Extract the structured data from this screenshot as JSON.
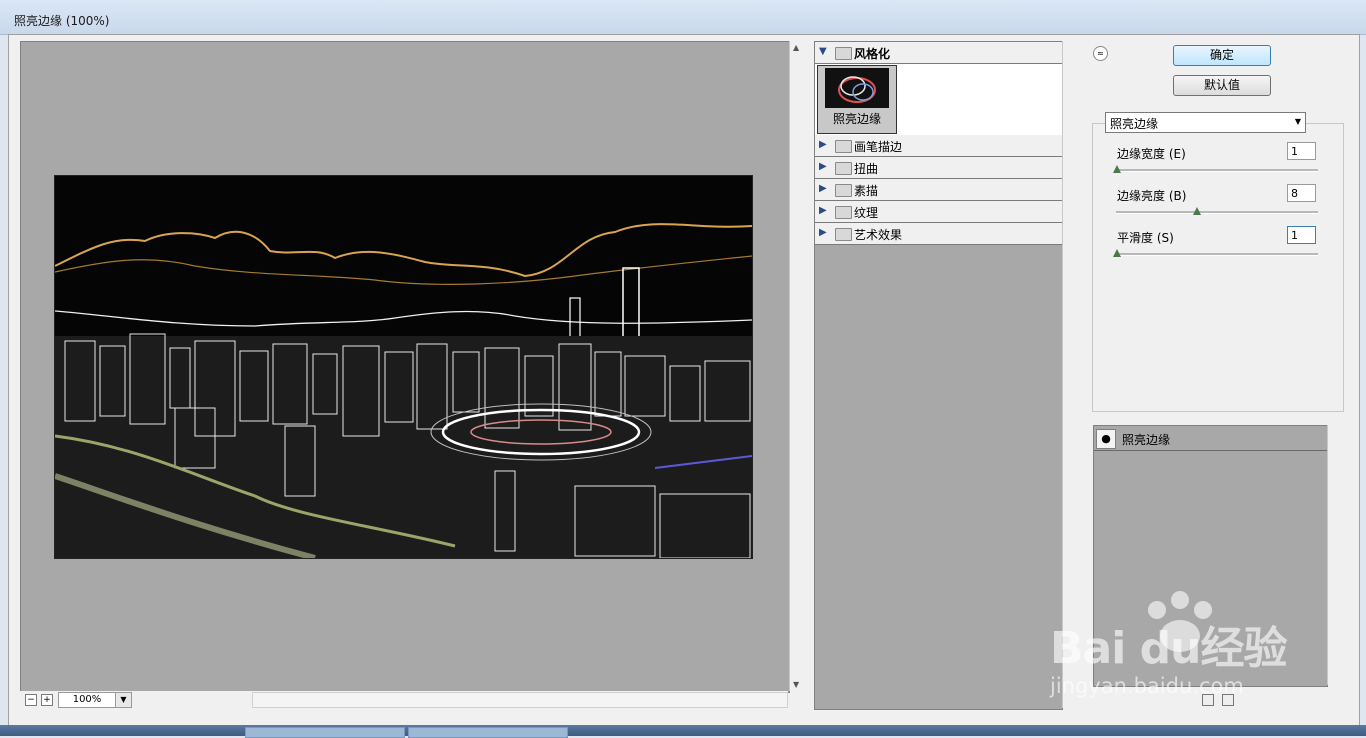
{
  "window": {
    "title": "照亮边缘 (100%)"
  },
  "preview": {
    "zoom": "100%",
    "zoom_out": "−",
    "zoom_in": "+"
  },
  "gallery": {
    "open_category": "风格化",
    "selected_filter": "照亮边缘",
    "categories": [
      "画笔描边",
      "扭曲",
      "素描",
      "纹理",
      "艺术效果"
    ]
  },
  "buttons": {
    "ok": "确定",
    "default": "默认值",
    "collapse": "≈"
  },
  "filter_select": {
    "value": "照亮边缘"
  },
  "params": [
    {
      "label": "边缘宽度 (E)",
      "value": "1",
      "level": 0.0
    },
    {
      "label": "边缘亮度 (B)",
      "value": "8",
      "level": 0.35
    },
    {
      "label": "平滑度 (S)",
      "value": "1",
      "level": 0.0
    }
  ],
  "layers": {
    "items": [
      "照亮边缘"
    ]
  },
  "watermark": {
    "brand": "Bai du经验",
    "url": "jingyan.baidu.com"
  },
  "colors": {
    "preview_bg": "#a8a8a8",
    "panel_bg": "#f0f0f0",
    "accent": "#3c7fb1"
  },
  "icons": {
    "eye": "eye-icon",
    "folder": "folder-icon",
    "triangle_open": "triangle-down-icon",
    "triangle_closed": "triangle-right-icon"
  }
}
